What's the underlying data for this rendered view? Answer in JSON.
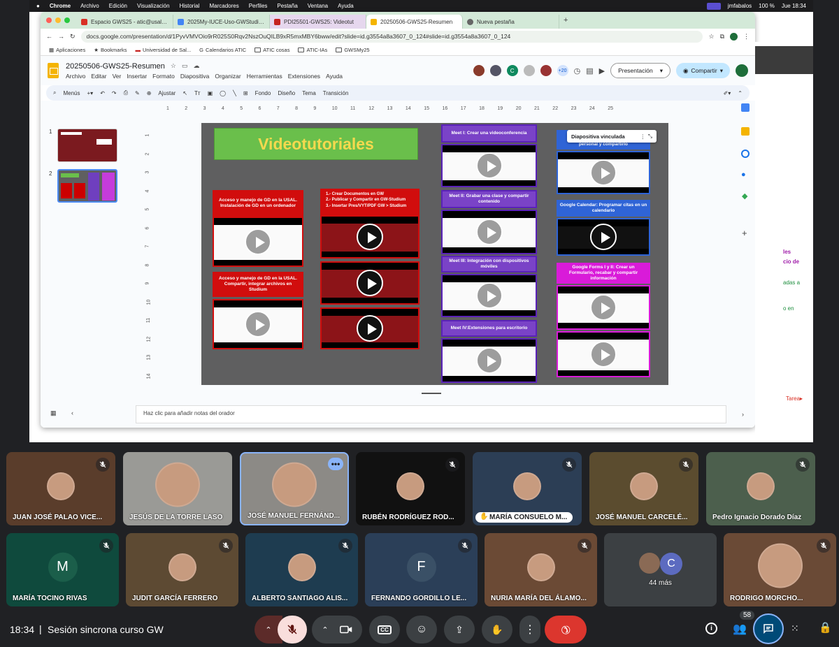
{
  "mac_menu": {
    "items": [
      "Chrome",
      "Archivo",
      "Edición",
      "Visualización",
      "Historial",
      "Marcadores",
      "Perfiles",
      "Pestaña",
      "Ventana",
      "Ayuda"
    ],
    "user": "jmfabalos",
    "battery": "100 %",
    "clock": "Jue 18:34"
  },
  "browser": {
    "tabs": [
      {
        "title": "Espacio GWS25 - atic@usal.es",
        "active": false,
        "color": "#d93025"
      },
      {
        "title": "2025My-IUCE-Uso-GWStudium",
        "active": false,
        "color": "#4285f4"
      },
      {
        "title": "PDI25501-GWS25: Videotut",
        "active": false,
        "color": "#f4b400"
      },
      {
        "title": "20250506-GWS25-Resumen",
        "active": true,
        "color": "#f4b400"
      },
      {
        "title": "Nueva pestaña",
        "active": false,
        "color": "#666"
      }
    ],
    "url": "docs.google.com/presentation/d/1PyvVMVOio9rR025S0Rqv2NszOuQILB9xR5mxMBY6bww/edit?slide=id.g3554a8a3607_0_124#slide=id.g3554a8a3607_0_124",
    "bookmarks": [
      "Aplicaciones",
      "Bookmarks",
      "Universidad de Sal...",
      "Calendarios ATIC",
      "ATIC cosas",
      "ATIC-IAs",
      "GWSMy25"
    ]
  },
  "slides": {
    "doc_title": "20250506-GWS25-Resumen",
    "menus": [
      "Archivo",
      "Editar",
      "Ver",
      "Insertar",
      "Formato",
      "Diapositiva",
      "Organizar",
      "Herramientas",
      "Extensiones",
      "Ayuda"
    ],
    "collaborators_more": "+20",
    "present_label": "Presentación",
    "share_label": "Compartir",
    "toolbar": {
      "menus": "Menús",
      "adjust": "Ajustar",
      "fondo": "Fondo",
      "diseno": "Diseño",
      "tema": "Tema",
      "transicion": "Transición"
    },
    "thumb_numbers": [
      "1",
      "2"
    ],
    "notes_placeholder": "Haz clic para añadir notas del orador",
    "ruler": [
      "1",
      "2",
      "3",
      "4",
      "5",
      "6",
      "7",
      "8",
      "9",
      "10",
      "11",
      "12",
      "13",
      "14",
      "15",
      "16",
      "17",
      "18",
      "19",
      "20",
      "21",
      "22",
      "23",
      "24",
      "25"
    ],
    "vruler": [
      "1",
      "2",
      "3",
      "4",
      "5",
      "6",
      "7",
      "8",
      "9",
      "10",
      "11",
      "12",
      "13",
      "14"
    ],
    "slide": {
      "title": "Videotutoriales",
      "col1": [
        "Acceso y manejo de GD en la USAL. Instalación de GD en un ordenador",
        "Acceso y manejo de GD en la USAL. Compartir, integrar archivos en Studium"
      ],
      "col2_header": [
        "1.- Crear Documentos en GW",
        "2.- Publicar y Compartir en GW-Studium",
        "3.- Insertar Pres/VYT/PDF GW > Studium"
      ],
      "col3": [
        "Meet I: Crear una videoconferencia",
        "Meet II: Grabar una clase y compartir contenido",
        "Meet III: Integración con dispositivos móviles",
        "Meet IV:Extensiones para escritorio"
      ],
      "col4": [
        "Diapositiva vinculada",
        "personal y compartirlo",
        "Google Calendar: Programar citas en un calendario",
        "Google Forms I y II: Crear un Formulario, recabar y compartir información"
      ]
    }
  },
  "right_pane": [
    "les",
    "cio de",
    "adas a",
    "o en",
    "Tarea▸"
  ],
  "meet": {
    "row1": [
      {
        "name": "JUAN JOSÉ PALAO VICE...",
        "muted": true,
        "bg": "#5a3d2b"
      },
      {
        "name": "JESÚS DE LA TORRE LASO",
        "muted": false,
        "bg": "#9a9a96"
      },
      {
        "name": "JOSÉ MANUEL FERNÁND...",
        "muted": false,
        "bg": "#8c8a86"
      },
      {
        "name": "RUBÉN RODRÍGUEZ ROD...",
        "muted": true,
        "bg": "#111111"
      },
      {
        "name": "MARÍA CONSUELO M...",
        "muted": true,
        "bg": "#2c3e55"
      },
      {
        "name": "JOSÉ MANUEL CARCELÉ...",
        "muted": true,
        "bg": "#5b4c2f"
      },
      {
        "name": "Pedro Ignacio Dorado Díaz",
        "muted": true,
        "bg": "#4c5f4d"
      }
    ],
    "row2": [
      {
        "name": "MARÍA TOCINO RIVAS",
        "muted": true,
        "bg": "#0f4a3d",
        "letter": "M",
        "lcolor": "#1b5e4a"
      },
      {
        "name": "JUDIT GARCÍA FERRERO",
        "muted": true,
        "bg": "#5d4a33"
      },
      {
        "name": "ALBERTO SANTIAGO ALIS...",
        "muted": true,
        "bg": "#1e3c50"
      },
      {
        "name": "FERNANDO GORDILLO LE...",
        "muted": true,
        "bg": "#2b3f58",
        "letter": "F",
        "lcolor": "#3a5066"
      },
      {
        "name": "NURIA MARÍA DEL ÁLAMO...",
        "muted": true,
        "bg": "#6b4a35"
      },
      {
        "name": "44 más",
        "muted": false,
        "bg": "#3c4043"
      },
      {
        "name": "RODRIGO MORCHO...",
        "muted": true,
        "bg": "#6a4a36"
      }
    ],
    "others_letter": "C",
    "time": "18:34",
    "meeting_title": "Sesión sincrona curso GW",
    "participants_count": "58"
  }
}
